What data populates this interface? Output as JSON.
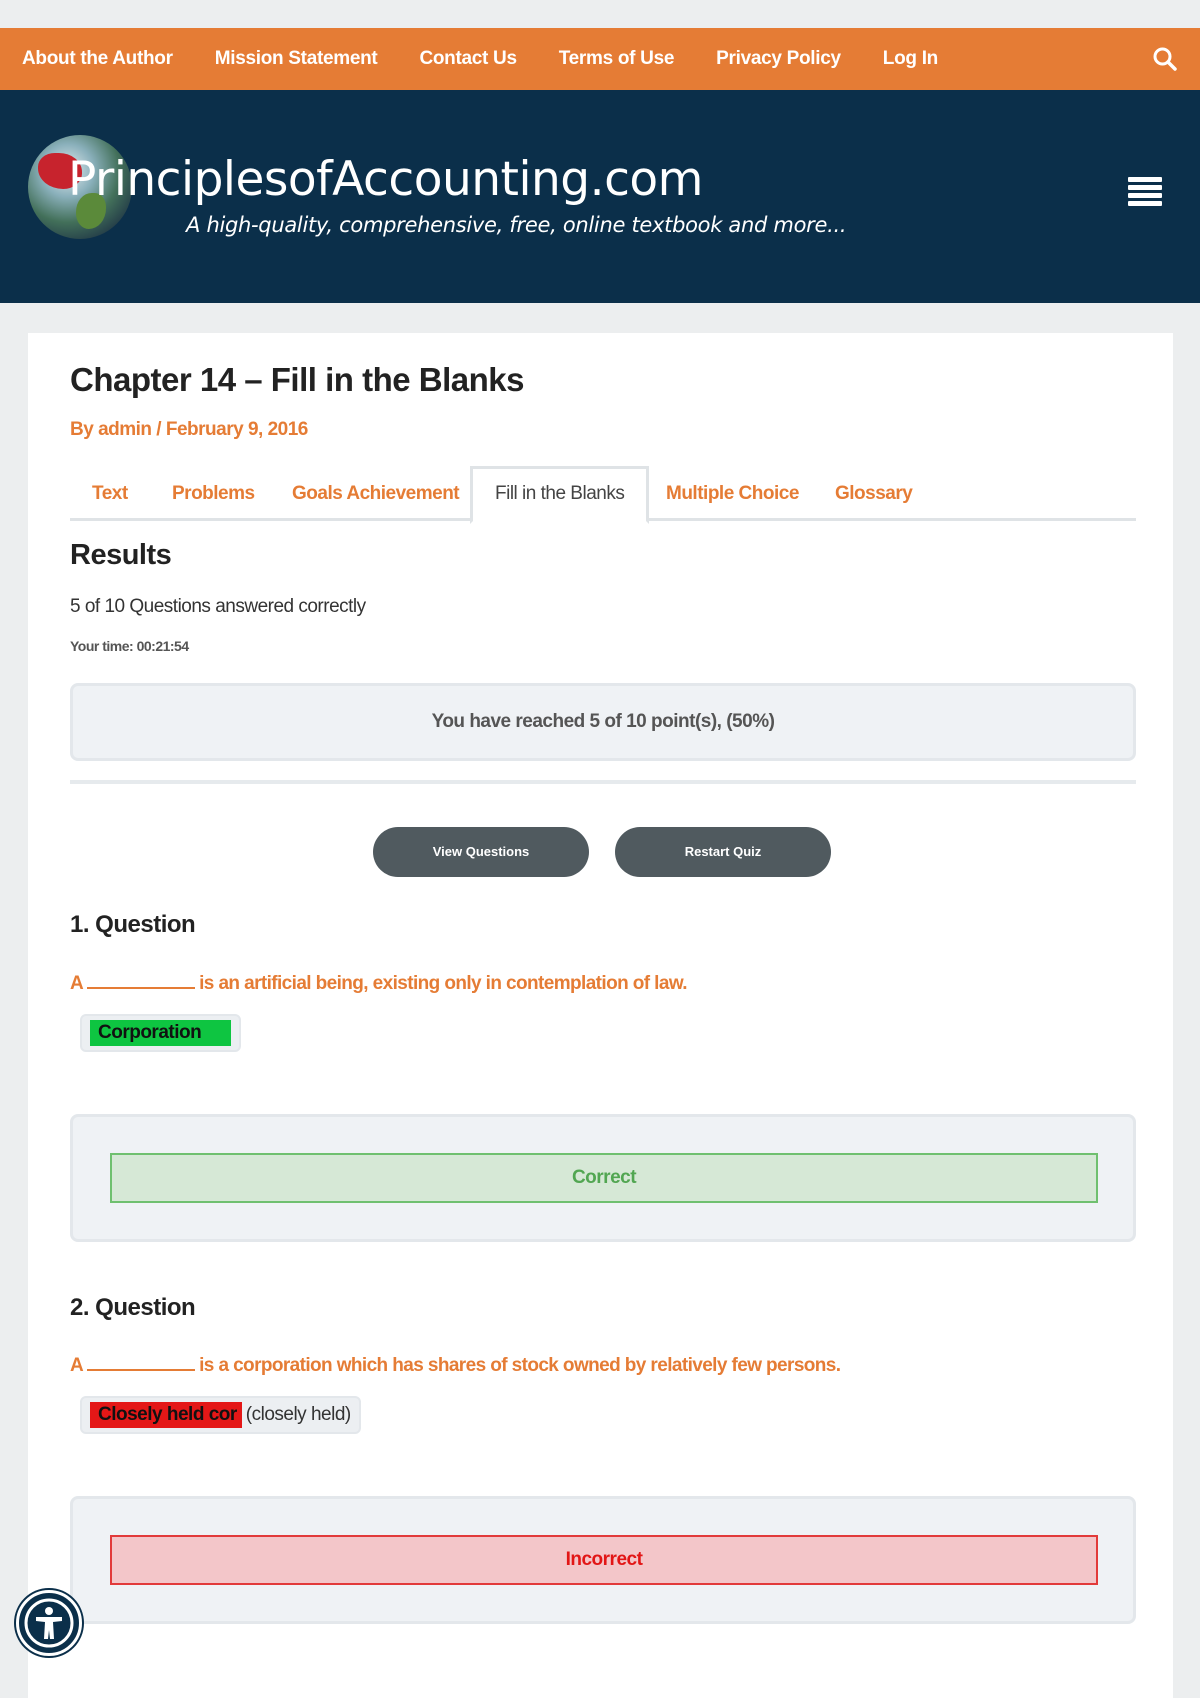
{
  "topnav": {
    "items": [
      {
        "label": "About the Author"
      },
      {
        "label": "Mission Statement"
      },
      {
        "label": "Contact Us"
      },
      {
        "label": "Terms of Use"
      },
      {
        "label": "Privacy Policy"
      },
      {
        "label": "Log In"
      }
    ]
  },
  "header": {
    "brand": "PrinciplesofAccounting.com",
    "tagline": "A high-quality, comprehensive, free, online textbook and more..."
  },
  "post": {
    "title": "Chapter 14 – Fill in the Blanks",
    "meta": "By admin / February 9, 2016"
  },
  "tabs": [
    {
      "label": "Text"
    },
    {
      "label": "Problems"
    },
    {
      "label": "Goals Achievement"
    },
    {
      "label": "Fill in the Blanks",
      "active": true
    },
    {
      "label": "Multiple Choice"
    },
    {
      "label": "Glossary"
    }
  ],
  "results": {
    "heading": "Results",
    "summary": "5 of 10 Questions answered correctly",
    "time": "Your time: 00:21:54",
    "points": "You have reached 5 of 10 point(s), (50%)"
  },
  "buttons": {
    "view_questions": "View Questions",
    "restart_quiz": "Restart Quiz"
  },
  "questions": [
    {
      "title": "1. Question",
      "prefix": "A",
      "suffix": "is an artificial being, existing only in contemplation of law.",
      "answer": "Corporation",
      "feedback": "Correct"
    },
    {
      "title": "2. Question",
      "prefix": "A",
      "suffix": "is a corporation which has shares of stock owned by relatively few persons.",
      "answer": "Closely held cor",
      "correct_answer": "(closely held)",
      "feedback": "Incorrect"
    }
  ],
  "colors": {
    "accent_orange": "#e57c35",
    "header_navy": "#0b2f4a",
    "correct_green": "#0ec541",
    "incorrect_red": "#e41717"
  }
}
